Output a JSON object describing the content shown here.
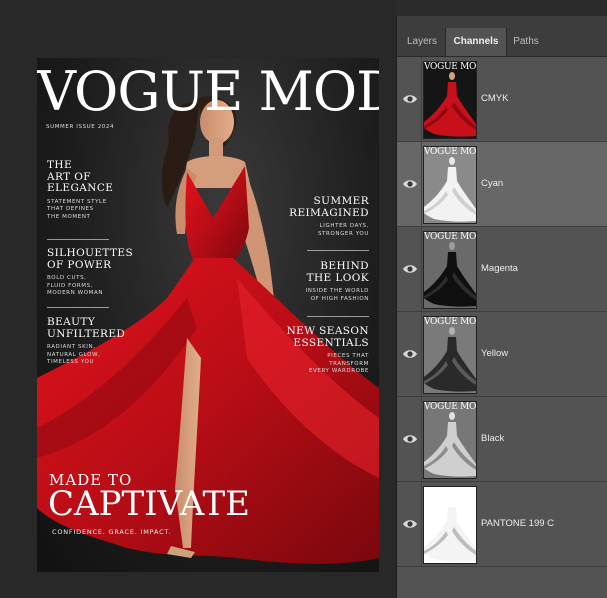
{
  "app": {
    "panel_tabs": [
      "Layers",
      "Channels",
      "Paths"
    ],
    "active_tab": "Channels"
  },
  "cover": {
    "masthead": "VOGUE MODE",
    "issue": "SUMMER ISSUE 2024",
    "left_blocks": [
      {
        "heading": "THE\nART OF\nELEGANCE",
        "sub": "STATEMENT STYLE\nTHAT DEFINES\nTHE MOMENT"
      },
      {
        "heading": "SILHOUETTES\nOF POWER",
        "sub": "BOLD CUTS,\nFLUID FORMS,\nMODERN WOMAN"
      },
      {
        "heading": "BEAUTY\nUNFILTERED",
        "sub": "RADIANT SKIN,\nNATURAL GLOW,\nTIMELESS YOU"
      }
    ],
    "right_blocks": [
      {
        "heading": "SUMMER\nREIMAGINED",
        "sub": "LIGHTER DAYS,\nSTRONGER YOU"
      },
      {
        "heading": "BEHIND\nTHE LOOK",
        "sub": "INSIDE THE WORLD\nOF HIGH FASHION"
      },
      {
        "heading": "NEW SEASON\nESSENTIALS",
        "sub": "PIECES THAT\nTRANSFORM\nEVERY WARDROBE"
      }
    ],
    "made_to": "MADE TO",
    "captivate": "CAPTIVATE",
    "tagline": "CONFIDENCE. GRACE. IMPACT."
  },
  "channels": [
    {
      "name": "CMYK",
      "selected": false,
      "style": "color",
      "visible": true,
      "icon": "eye-icon"
    },
    {
      "name": "Cyan",
      "selected": true,
      "style": "cyan",
      "visible": true,
      "icon": "eye-icon"
    },
    {
      "name": "Magenta",
      "selected": false,
      "style": "magenta",
      "visible": true,
      "icon": "eye-icon"
    },
    {
      "name": "Yellow",
      "selected": false,
      "style": "yellow",
      "visible": true,
      "icon": "eye-icon"
    },
    {
      "name": "Black",
      "selected": false,
      "style": "black",
      "visible": true,
      "icon": "eye-icon"
    },
    {
      "name": "PANTONE 199 C",
      "selected": false,
      "style": "spot",
      "visible": true,
      "icon": "eye-icon"
    }
  ],
  "colors": {
    "dress_red": "#c8101a",
    "panel_bg": "#535353",
    "selected_row": "#676767",
    "tab_bar": "#3d3d3d"
  }
}
